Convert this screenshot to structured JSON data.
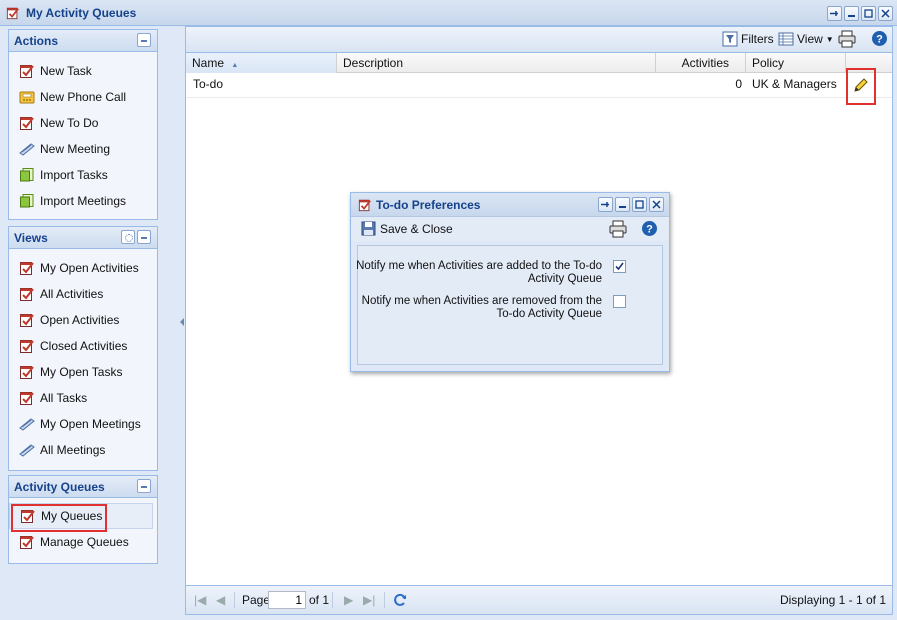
{
  "window": {
    "title": "My Activity Queues"
  },
  "sidebar": {
    "actions": {
      "title": "Actions",
      "items": [
        {
          "label": "New Task",
          "icon": "task-icon"
        },
        {
          "label": "New Phone Call",
          "icon": "phone-call-icon"
        },
        {
          "label": "New To Do",
          "icon": "todo-icon"
        },
        {
          "label": "New Meeting",
          "icon": "meeting-icon"
        },
        {
          "label": "Import Tasks",
          "icon": "import-icon"
        },
        {
          "label": "Import Meetings",
          "icon": "import-icon"
        }
      ]
    },
    "views": {
      "title": "Views",
      "items": [
        {
          "label": "My Open Activities",
          "icon": "task-icon"
        },
        {
          "label": "All Activities",
          "icon": "task-icon"
        },
        {
          "label": "Open Activities",
          "icon": "task-icon"
        },
        {
          "label": "Closed Activities",
          "icon": "task-icon"
        },
        {
          "label": "My Open Tasks",
          "icon": "task-icon"
        },
        {
          "label": "All Tasks",
          "icon": "task-icon"
        },
        {
          "label": "My Open Meetings",
          "icon": "meeting-icon"
        },
        {
          "label": "All Meetings",
          "icon": "meeting-icon"
        }
      ]
    },
    "queues": {
      "title": "Activity Queues",
      "items": [
        {
          "label": "My Queues",
          "icon": "task-icon",
          "selected": true
        },
        {
          "label": "Manage Queues",
          "icon": "task-icon"
        }
      ]
    }
  },
  "toolbar": {
    "filters_label": "Filters",
    "view_label": "View"
  },
  "grid": {
    "columns": [
      "Name",
      "Description",
      "Activities",
      "Policy"
    ],
    "sorted_column": "Name",
    "rows": [
      {
        "name": "To-do",
        "description": "",
        "activities": "0",
        "policy": "UK & Managers"
      }
    ]
  },
  "pager": {
    "page_label": "Page",
    "page_value": "1",
    "of_label": "of 1",
    "displaying": "Displaying 1 - 1 of 1"
  },
  "dialog": {
    "title": "To-do Preferences",
    "save_close_label": "Save & Close",
    "prefs": [
      {
        "label": "Notify me when Activities are added to the To-do Activity Queue",
        "checked": true
      },
      {
        "label": "Notify me when Activities are removed from the To-do Activity Queue",
        "checked": false
      }
    ]
  },
  "colors": {
    "accent_border": "#99bbe8",
    "title_text": "#15428b",
    "highlight_box": "#e03030"
  }
}
